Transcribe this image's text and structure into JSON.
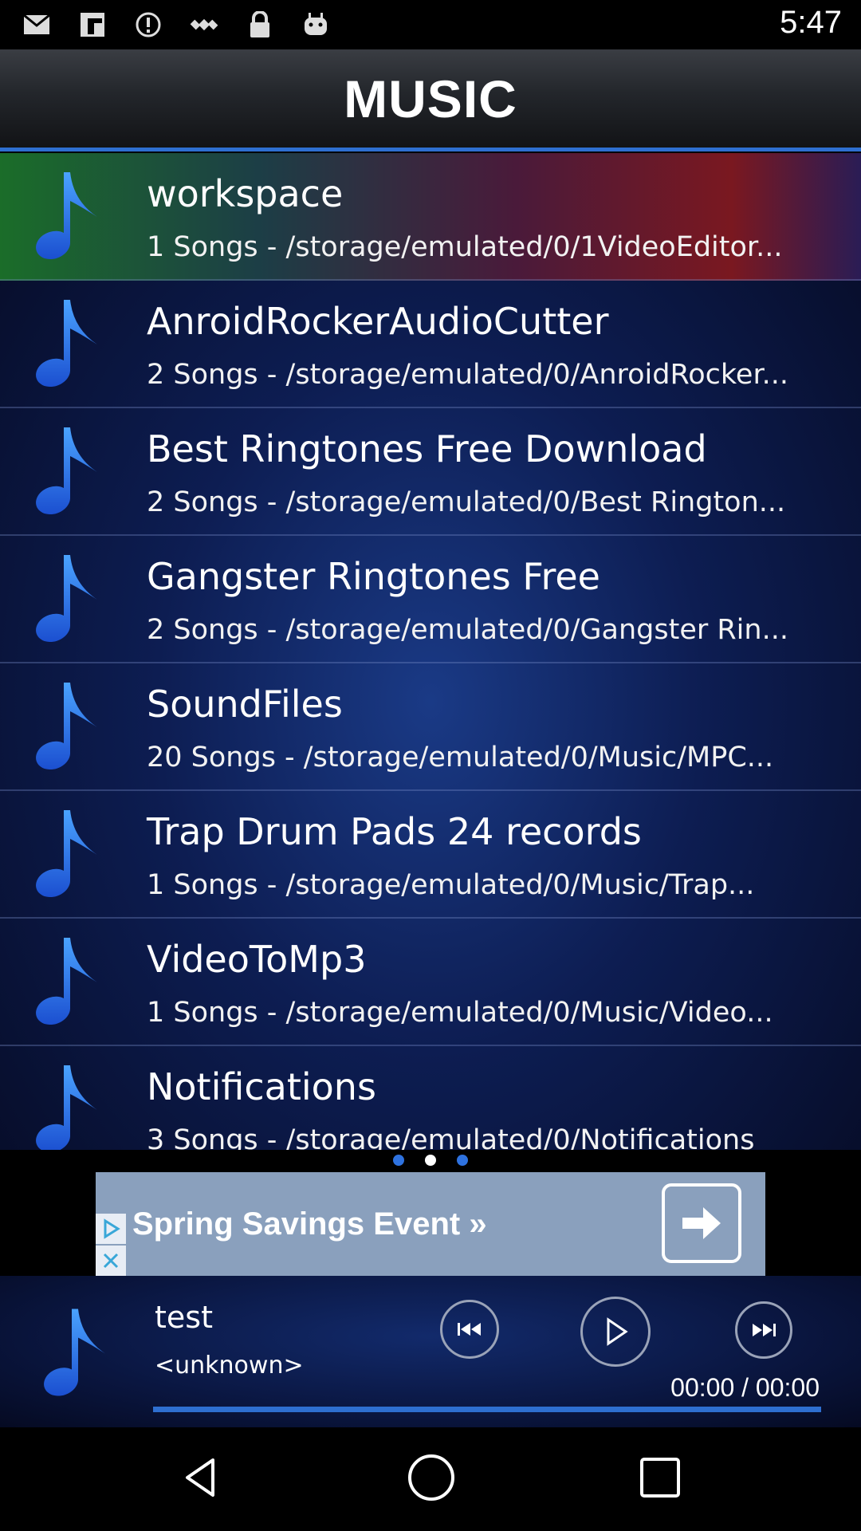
{
  "status": {
    "time": "5:47",
    "icons": [
      "mail-icon",
      "flipboard-icon",
      "alert-icon",
      "satellite-icon",
      "lock-icon",
      "android-icon"
    ]
  },
  "header": {
    "title": "MUSIC"
  },
  "colors": {
    "accent": "#2e6fd0",
    "note": "#2f7be8"
  },
  "folders": [
    {
      "title": "workspace",
      "subtitle": "1 Songs - /storage/emulated/0/1VideoEditor...",
      "active": true
    },
    {
      "title": "AnroidRockerAudioCutter",
      "subtitle": "2 Songs - /storage/emulated/0/AnroidRocker..."
    },
    {
      "title": "Best Ringtones Free Download",
      "subtitle": "2 Songs - /storage/emulated/0/Best Rington..."
    },
    {
      "title": "Gangster Ringtones Free",
      "subtitle": "2 Songs - /storage/emulated/0/Gangster Rin..."
    },
    {
      "title": "SoundFiles",
      "subtitle": "20 Songs - /storage/emulated/0/Music/MPC..."
    },
    {
      "title": "Trap Drum Pads 24 records",
      "subtitle": "1 Songs - /storage/emulated/0/Music/Trap..."
    },
    {
      "title": "VideoToMp3",
      "subtitle": "1 Songs - /storage/emulated/0/Music/Video..."
    },
    {
      "title": "Notifications",
      "subtitle": "3 Songs - /storage/emulated/0/Notifications"
    }
  ],
  "ad": {
    "text": "Spring Savings Event »"
  },
  "player": {
    "title": "test",
    "artist": "<unknown>",
    "time": "00:00 / 00:00"
  }
}
